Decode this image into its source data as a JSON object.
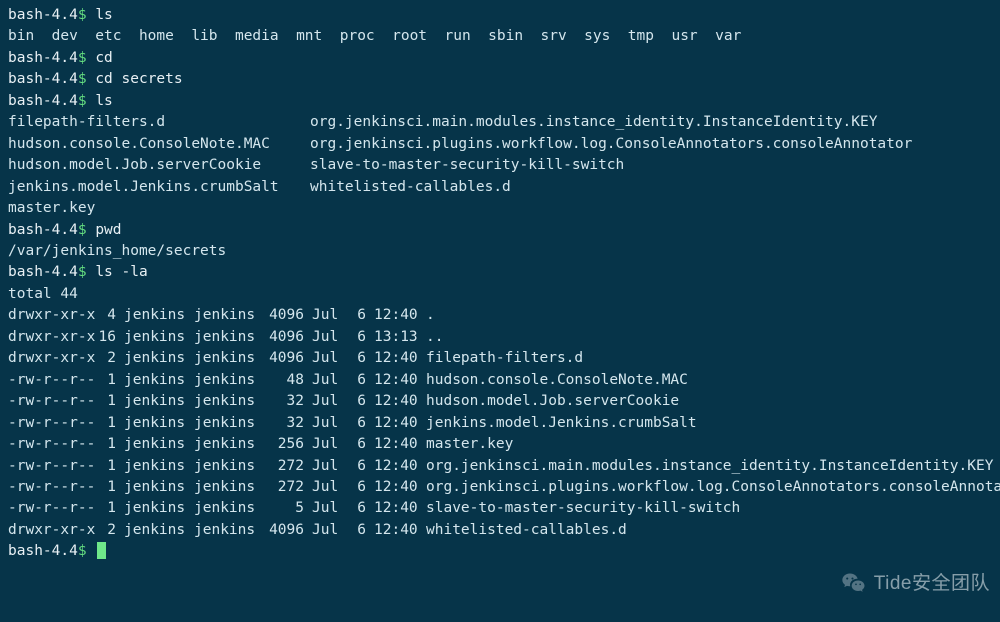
{
  "prompt": "bash-4.4",
  "dollar": "$",
  "commands": {
    "ls1": "ls",
    "cd1": "cd",
    "cd2": "cd secrets",
    "ls2": "ls",
    "pwd": "pwd",
    "lsla": "ls -la"
  },
  "root_dirs": [
    "bin",
    "dev",
    "etc",
    "home",
    "lib",
    "media",
    "mnt",
    "proc",
    "root",
    "run",
    "sbin",
    "srv",
    "sys",
    "tmp",
    "usr",
    "var"
  ],
  "secrets_ls": [
    [
      "filepath-filters.d",
      "org.jenkinsci.main.modules.instance_identity.InstanceIdentity.KEY"
    ],
    [
      "hudson.console.ConsoleNote.MAC",
      "org.jenkinsci.plugins.workflow.log.ConsoleAnnotators.consoleAnnotator"
    ],
    [
      "hudson.model.Job.serverCookie",
      "slave-to-master-security-kill-switch"
    ],
    [
      "jenkins.model.Jenkins.crumbSalt",
      "whitelisted-callables.d"
    ],
    [
      "master.key",
      ""
    ]
  ],
  "pwd_output": "/var/jenkins_home/secrets",
  "lsla_total": "total 44",
  "lsla_rows": [
    {
      "perm": "drwxr-xr-x",
      "ln": "4",
      "u": "jenkins",
      "g": "jenkins",
      "sz": "4096",
      "mo": "Jul",
      "d": "6",
      "t": "12:40",
      "name": "."
    },
    {
      "perm": "drwxr-xr-x",
      "ln": "16",
      "u": "jenkins",
      "g": "jenkins",
      "sz": "4096",
      "mo": "Jul",
      "d": "6",
      "t": "13:13",
      "name": ".."
    },
    {
      "perm": "drwxr-xr-x",
      "ln": "2",
      "u": "jenkins",
      "g": "jenkins",
      "sz": "4096",
      "mo": "Jul",
      "d": "6",
      "t": "12:40",
      "name": "filepath-filters.d"
    },
    {
      "perm": "-rw-r--r--",
      "ln": "1",
      "u": "jenkins",
      "g": "jenkins",
      "sz": "48",
      "mo": "Jul",
      "d": "6",
      "t": "12:40",
      "name": "hudson.console.ConsoleNote.MAC"
    },
    {
      "perm": "-rw-r--r--",
      "ln": "1",
      "u": "jenkins",
      "g": "jenkins",
      "sz": "32",
      "mo": "Jul",
      "d": "6",
      "t": "12:40",
      "name": "hudson.model.Job.serverCookie"
    },
    {
      "perm": "-rw-r--r--",
      "ln": "1",
      "u": "jenkins",
      "g": "jenkins",
      "sz": "32",
      "mo": "Jul",
      "d": "6",
      "t": "12:40",
      "name": "jenkins.model.Jenkins.crumbSalt"
    },
    {
      "perm": "-rw-r--r--",
      "ln": "1",
      "u": "jenkins",
      "g": "jenkins",
      "sz": "256",
      "mo": "Jul",
      "d": "6",
      "t": "12:40",
      "name": "master.key"
    },
    {
      "perm": "-rw-r--r--",
      "ln": "1",
      "u": "jenkins",
      "g": "jenkins",
      "sz": "272",
      "mo": "Jul",
      "d": "6",
      "t": "12:40",
      "name": "org.jenkinsci.main.modules.instance_identity.InstanceIdentity.KEY"
    },
    {
      "perm": "-rw-r--r--",
      "ln": "1",
      "u": "jenkins",
      "g": "jenkins",
      "sz": "272",
      "mo": "Jul",
      "d": "6",
      "t": "12:40",
      "name": "org.jenkinsci.plugins.workflow.log.ConsoleAnnotators.consoleAnnotator"
    },
    {
      "perm": "-rw-r--r--",
      "ln": "1",
      "u": "jenkins",
      "g": "jenkins",
      "sz": "5",
      "mo": "Jul",
      "d": "6",
      "t": "12:40",
      "name": "slave-to-master-security-kill-switch"
    },
    {
      "perm": "drwxr-xr-x",
      "ln": "2",
      "u": "jenkins",
      "g": "jenkins",
      "sz": "4096",
      "mo": "Jul",
      "d": "6",
      "t": "12:40",
      "name": "whitelisted-callables.d"
    }
  ],
  "watermark": "Tide安全团队"
}
